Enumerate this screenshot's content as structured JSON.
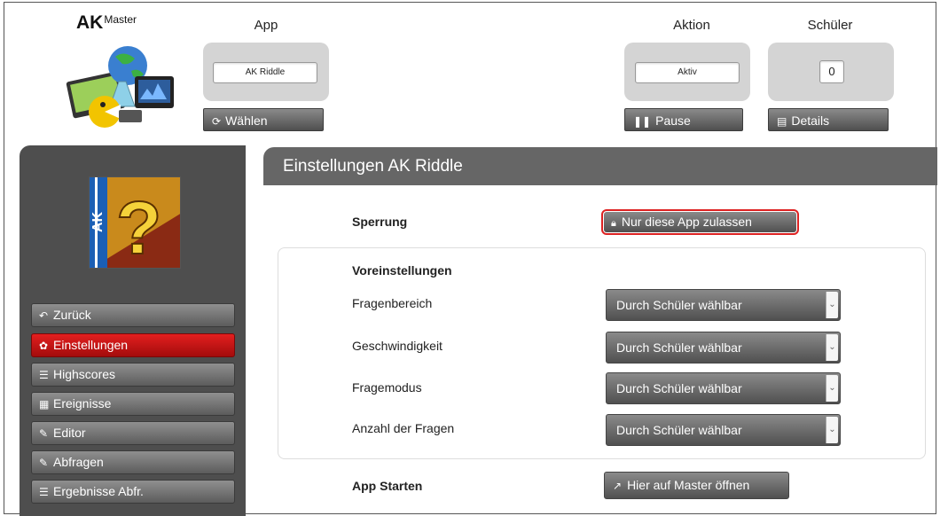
{
  "brand": {
    "main": "AK",
    "sub": "Master"
  },
  "header": {
    "app": {
      "label": "App",
      "value": "AK Riddle",
      "button": "Wählen"
    },
    "aktion": {
      "label": "Aktion",
      "value": "Aktiv",
      "button": "Pause"
    },
    "schueler": {
      "label": "Schüler",
      "value": "0",
      "button": "Details"
    }
  },
  "sidebar": {
    "items": [
      {
        "label": "Zurück",
        "icon": "undo-icon"
      },
      {
        "label": "Einstellungen",
        "icon": "gear-icon",
        "active": true
      },
      {
        "label": "Highscores",
        "icon": "list-icon"
      },
      {
        "label": "Ereignisse",
        "icon": "calendar-icon"
      },
      {
        "label": "Editor",
        "icon": "edit-icon"
      },
      {
        "label": "Abfragen",
        "icon": "edit-icon"
      },
      {
        "label": "Ergebnisse Abfr.",
        "icon": "numbered-list-icon"
      }
    ]
  },
  "main": {
    "title": "Einstellungen AK Riddle",
    "sperrung": {
      "label": "Sperrung",
      "button": "Nur diese App zulassen"
    },
    "voreinstellungen": {
      "title": "Voreinstellungen",
      "rows": [
        {
          "label": "Fragenbereich",
          "value": "Durch Schüler wählbar"
        },
        {
          "label": "Geschwindigkeit",
          "value": "Durch Schüler wählbar"
        },
        {
          "label": "Fragemodus",
          "value": "Durch Schüler wählbar"
        },
        {
          "label": "Anzahl der Fragen",
          "value": "Durch Schüler wählbar"
        }
      ]
    },
    "start": {
      "label": "App Starten",
      "button": "Hier auf Master öffnen"
    }
  },
  "colors": {
    "active": "#c41414",
    "button": "#5c5c5c",
    "sidebar": "#4e4e4e",
    "header_bar": "#666666",
    "highlight_border": "#dd2222"
  }
}
